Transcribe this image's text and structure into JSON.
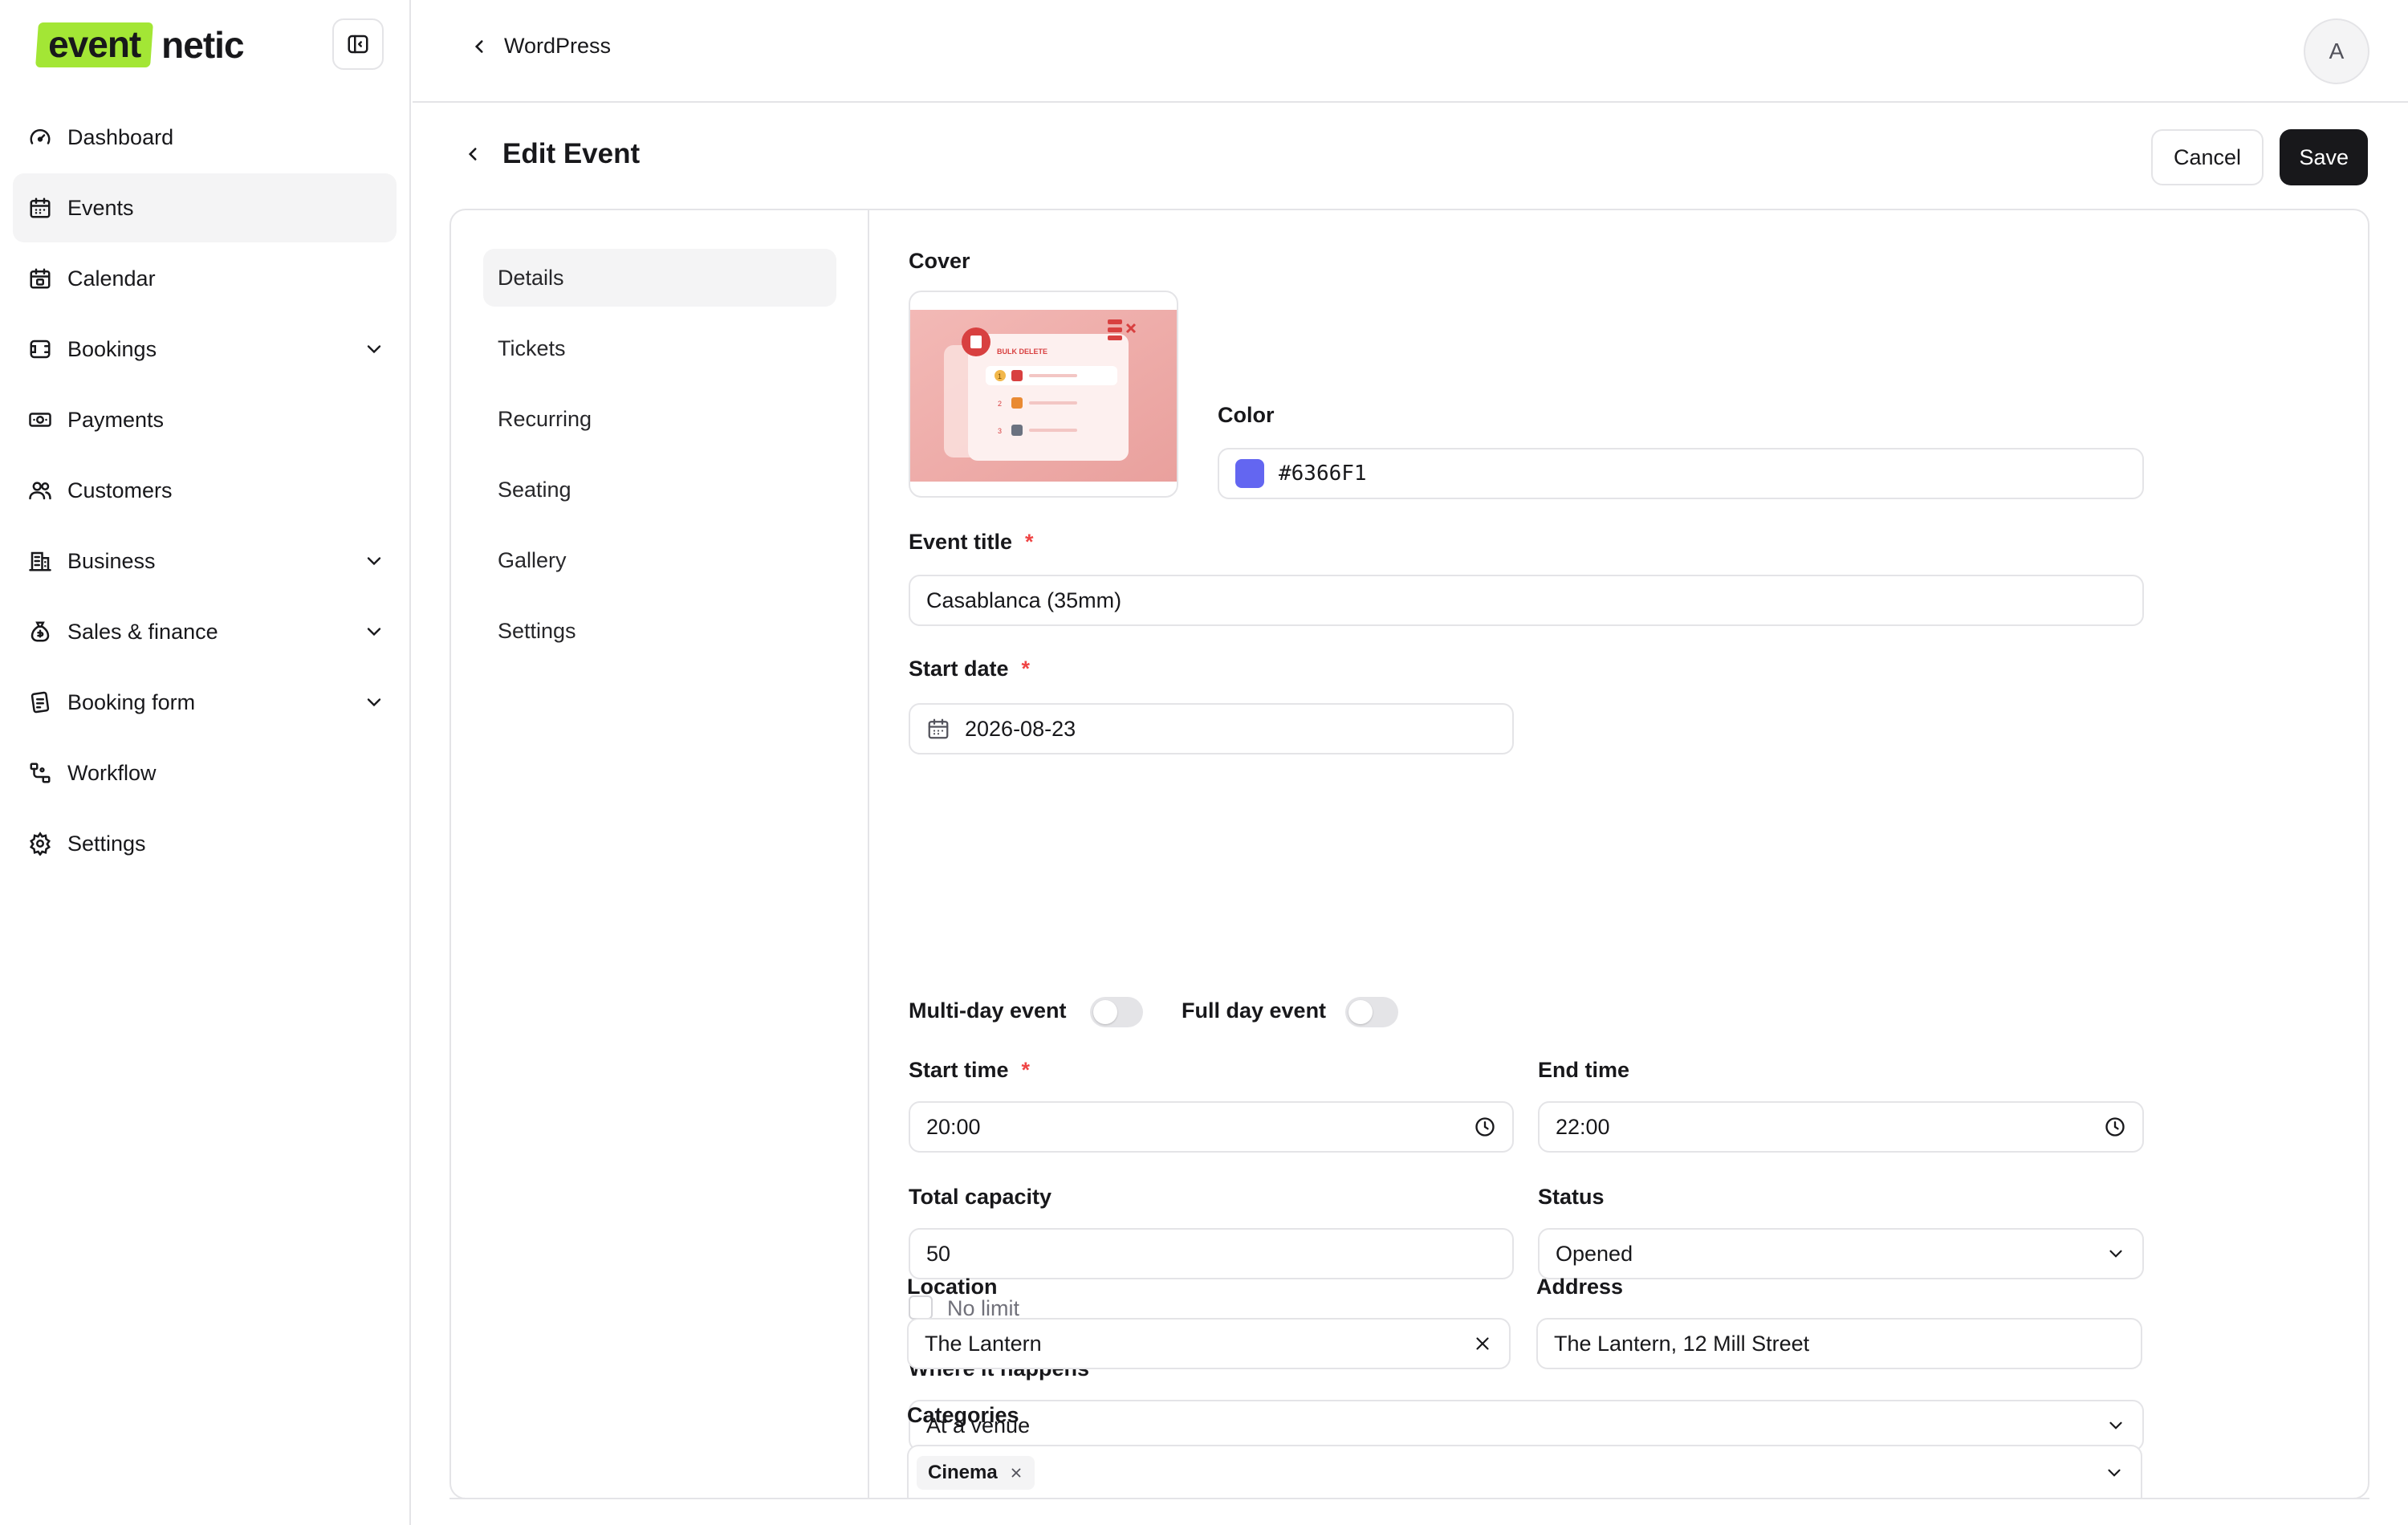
{
  "app": {
    "logo_highlight": "event",
    "logo_rest": "netic"
  },
  "sidebar": {
    "items": [
      {
        "label": "Dashboard",
        "icon": "dashboard-gauge-icon",
        "active": false,
        "expandable": false
      },
      {
        "label": "Events",
        "icon": "calendar-icon",
        "active": true,
        "expandable": false
      },
      {
        "label": "Calendar",
        "icon": "calendar-days-icon",
        "active": false,
        "expandable": false
      },
      {
        "label": "Bookings",
        "icon": "bookings-icon",
        "active": false,
        "expandable": true
      },
      {
        "label": "Payments",
        "icon": "banknote-icon",
        "active": false,
        "expandable": false
      },
      {
        "label": "Customers",
        "icon": "users-icon",
        "active": false,
        "expandable": false
      },
      {
        "label": "Business",
        "icon": "building-icon",
        "active": false,
        "expandable": true
      },
      {
        "label": "Sales & finance",
        "icon": "money-bag-icon",
        "active": false,
        "expandable": true
      },
      {
        "label": "Booking form",
        "icon": "form-icon",
        "active": false,
        "expandable": true
      },
      {
        "label": "Workflow",
        "icon": "workflow-icon",
        "active": false,
        "expandable": false
      },
      {
        "label": "Settings",
        "icon": "gear-icon",
        "active": false,
        "expandable": false
      }
    ]
  },
  "topbar": {
    "back_label": "WordPress",
    "avatar_initial": "A"
  },
  "header": {
    "title": "Edit Event",
    "cancel_label": "Cancel",
    "save_label": "Save"
  },
  "subnav": {
    "items": [
      {
        "label": "Details",
        "active": true
      },
      {
        "label": "Tickets",
        "active": false
      },
      {
        "label": "Recurring",
        "active": false
      },
      {
        "label": "Seating",
        "active": false
      },
      {
        "label": "Gallery",
        "active": false
      },
      {
        "label": "Settings",
        "active": false
      }
    ]
  },
  "form": {
    "cover_label": "Cover",
    "cover_image": {
      "badge": "BULK DELETE",
      "rows": [
        "1",
        "2",
        "3"
      ]
    },
    "color_label": "Color",
    "color_value": "#6366F1",
    "event_title_label": "Event title",
    "event_title_value": "Casablanca (35mm)",
    "start_date_label": "Start date",
    "start_date_value": "2026-08-23",
    "multi_day_label": "Multi-day event",
    "multi_day_on": false,
    "full_day_label": "Full day event",
    "full_day_on": false,
    "start_time_label": "Start time",
    "start_time_value": "20:00",
    "end_time_label": "End time",
    "end_time_value": "22:00",
    "capacity_label": "Total capacity",
    "capacity_value": "50",
    "no_limit_label": "No limit",
    "no_limit_checked": false,
    "status_label": "Status",
    "status_value": "Opened",
    "where_label": "Where it happens",
    "where_value": "At a venue",
    "location_label": "Location",
    "location_value": "The Lantern",
    "address_label": "Address",
    "address_value": "The Lantern, 12 Mill Street",
    "categories_label": "Categories",
    "categories": [
      "Cinema"
    ],
    "required_mark": "*"
  },
  "colors": {
    "accent": "#6366F1",
    "logo_green": "#a3e635",
    "primary_button": "#18181b",
    "required": "#ef4444"
  }
}
